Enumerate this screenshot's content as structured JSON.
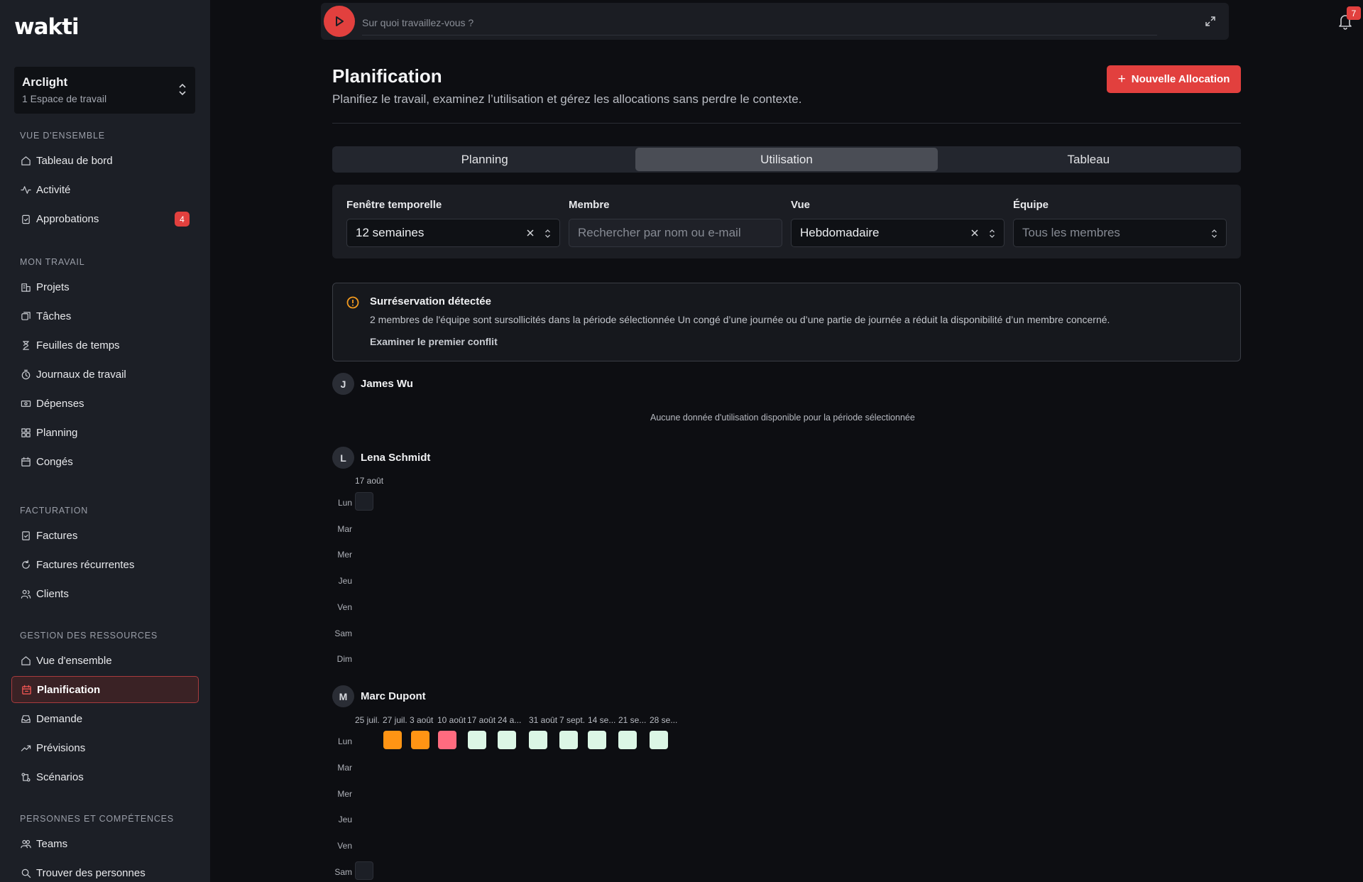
{
  "brand": {
    "logo": "wakti"
  },
  "workspace": {
    "name": "Arclight",
    "subtitle": "1 Espace de travail"
  },
  "sidebar": {
    "sections": [
      {
        "heading": "VUE D'ENSEMBLE",
        "items": [
          {
            "label": "Tableau de bord",
            "icon": "home-icon"
          },
          {
            "label": "Activité",
            "icon": "activity-icon"
          },
          {
            "label": "Approbations",
            "icon": "clipboard-check-icon",
            "badge": "4"
          }
        ]
      },
      {
        "heading": "MON TRAVAIL",
        "items": [
          {
            "label": "Projets",
            "icon": "building-icon"
          },
          {
            "label": "Tâches",
            "icon": "tasks-icon"
          },
          {
            "label": "Feuilles de temps",
            "icon": "hourglass-icon"
          },
          {
            "label": "Journaux de travail",
            "icon": "clock-icon"
          },
          {
            "label": "Dépenses",
            "icon": "banknote-icon"
          },
          {
            "label": "Planning",
            "icon": "grid-icon"
          },
          {
            "label": "Congés",
            "icon": "calendar-icon"
          }
        ]
      },
      {
        "heading": "FACTURATION",
        "items": [
          {
            "label": "Factures",
            "icon": "invoice-icon"
          },
          {
            "label": "Factures récurrentes",
            "icon": "refresh-icon"
          },
          {
            "label": "Clients",
            "icon": "users-icon"
          }
        ]
      },
      {
        "heading": "GESTION DES RESSOURCES",
        "items": [
          {
            "label": "Vue d'ensemble",
            "icon": "home-icon"
          },
          {
            "label": "Planification",
            "icon": "calendar-plan-icon",
            "active": true
          },
          {
            "label": "Demande",
            "icon": "inbox-icon"
          },
          {
            "label": "Prévisions",
            "icon": "trending-up-icon"
          },
          {
            "label": "Scénarios",
            "icon": "branch-icon"
          }
        ]
      },
      {
        "heading": "PERSONNES ET COMPÉTENCES",
        "items": [
          {
            "label": "Teams",
            "icon": "team-icon"
          },
          {
            "label": "Trouver des personnes",
            "icon": "search-icon"
          }
        ]
      }
    ]
  },
  "topbar": {
    "placeholder": "Sur quoi travaillez-vous ?",
    "notifications": "7"
  },
  "page": {
    "title": "Planification",
    "subtitle": "Planifiez le travail, examinez l’utilisation et gérez les allocations sans perdre le contexte.",
    "new_button": "Nouvelle Allocation"
  },
  "tabs": [
    {
      "label": "Planning",
      "active": false
    },
    {
      "label": "Utilisation",
      "active": true
    },
    {
      "label": "Tableau",
      "active": false
    }
  ],
  "filters": {
    "window": {
      "label": "Fenêtre temporelle",
      "value": "12 semaines"
    },
    "member": {
      "label": "Membre",
      "placeholder": "Rechercher par nom ou e-mail"
    },
    "view": {
      "label": "Vue",
      "value": "Hebdomadaire"
    },
    "team": {
      "label": "Équipe",
      "placeholder": "Tous les membres"
    }
  },
  "alert": {
    "title": "Surréservation détectée",
    "description": "2 membres de l'équipe sont sursollicités dans la période sélectionnée Un congé d’une journée ou d’une partie de journée a réduit la disponibilité d’un membre concerné.",
    "link": "Examiner le premier conflit"
  },
  "colors": {
    "accent": "#e2403e",
    "over": "#ff9414",
    "high": "#ff6b7f",
    "ok": "#dbf6e5",
    "empty": "#1c1f26"
  },
  "members": [
    {
      "initial": "J",
      "name": "James Wu",
      "empty_message": "Aucune donnée d'utilisation disponible pour la période sélectionnée"
    },
    {
      "initial": "L",
      "name": "Lena Schmidt",
      "weeks": [
        "17 août"
      ],
      "days": [
        "Lun",
        "Mar",
        "Mer",
        "Jeu",
        "Ven",
        "Sam",
        "Dim"
      ],
      "cells": [
        {
          "week": 0,
          "day": 0,
          "status": "empty"
        }
      ]
    },
    {
      "initial": "M",
      "name": "Marc Dupont",
      "weeks": [
        "25 juil.",
        "27 juil.",
        "3 août",
        "10 août",
        "17 août",
        "24 a...",
        "31 août",
        "7 sept.",
        "14 se...",
        "21 se...",
        "28 se..."
      ],
      "days": [
        "Lun",
        "Mar",
        "Mer",
        "Jeu",
        "Ven",
        "Sam"
      ],
      "cells": [
        {
          "week": 1,
          "day": 0,
          "status": "over"
        },
        {
          "week": 2,
          "day": 0,
          "status": "over"
        },
        {
          "week": 3,
          "day": 0,
          "status": "high"
        },
        {
          "week": 4,
          "day": 0,
          "status": "ok"
        },
        {
          "week": 5,
          "day": 0,
          "status": "ok"
        },
        {
          "week": 6,
          "day": 0,
          "status": "ok"
        },
        {
          "week": 7,
          "day": 0,
          "status": "ok"
        },
        {
          "week": 8,
          "day": 0,
          "status": "ok"
        },
        {
          "week": 9,
          "day": 0,
          "status": "ok"
        },
        {
          "week": 10,
          "day": 0,
          "status": "ok"
        },
        {
          "week": 0,
          "day": 5,
          "status": "empty"
        }
      ]
    }
  ]
}
